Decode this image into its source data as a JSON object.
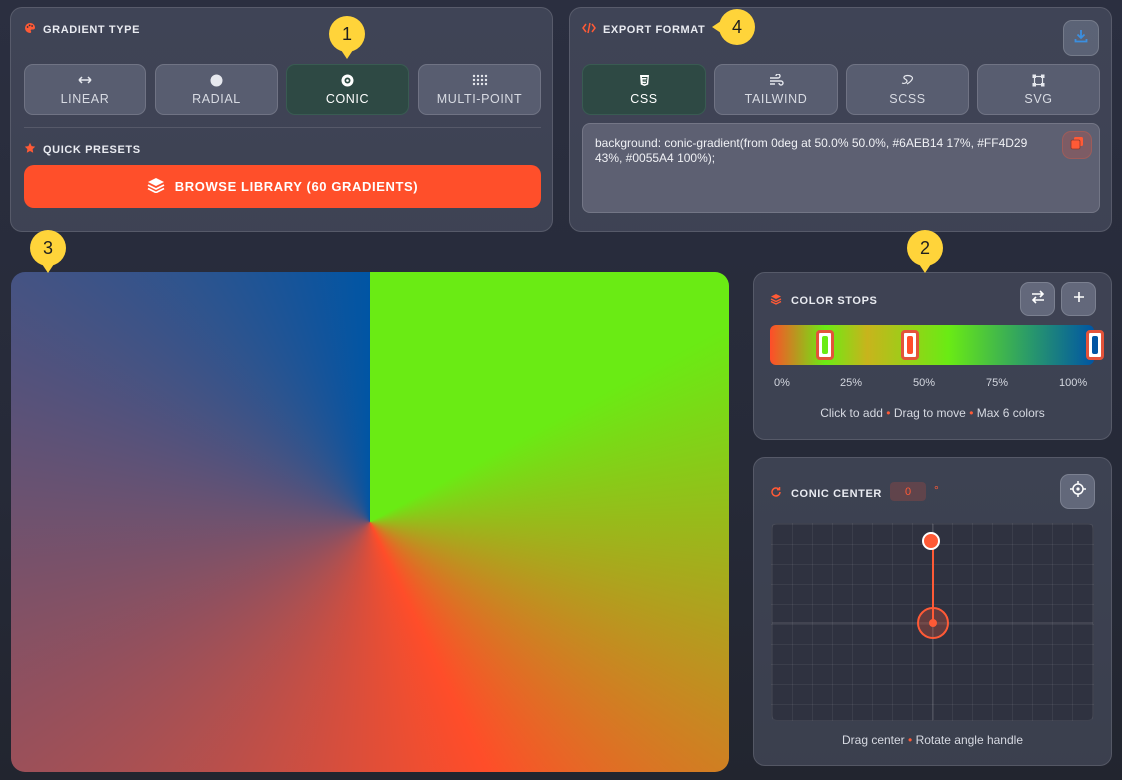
{
  "gradient_type": {
    "title": "GRADIENT TYPE",
    "buttons": [
      {
        "label": "LINEAR",
        "icon": "arrows-horizontal-icon"
      },
      {
        "label": "RADIAL",
        "icon": "circle-icon"
      },
      {
        "label": "CONIC",
        "icon": "conic-icon",
        "active": true
      },
      {
        "label": "MULTI-POINT",
        "icon": "grid-dots-icon"
      }
    ]
  },
  "presets": {
    "title": "QUICK PRESETS",
    "browse_label": "BROWSE LIBRARY (60 GRADIENTS)"
  },
  "export": {
    "title": "EXPORT FORMAT",
    "formats": [
      {
        "label": "CSS",
        "icon": "css3-icon",
        "active": true
      },
      {
        "label": "TAILWIND",
        "icon": "wind-icon"
      },
      {
        "label": "SCSS",
        "icon": "sass-icon"
      },
      {
        "label": "SVG",
        "icon": "vector-square-icon"
      }
    ],
    "code": "background: conic-gradient(from 0deg at 50.0% 50.0%, #6AEB14 17%, #FF4D29 43%, #0055A4 100%);"
  },
  "color_stops": {
    "title": "COLOR STOPS",
    "stops": [
      {
        "color": "#6AEB14",
        "position": 17
      },
      {
        "color": "#FF4D29",
        "position": 43
      },
      {
        "color": "#0055A4",
        "position": 100
      }
    ],
    "ticks": [
      "0%",
      "25%",
      "50%",
      "75%",
      "100%"
    ],
    "hint_parts": [
      "Click to add",
      "Drag to move",
      "Max 6 colors"
    ]
  },
  "conic_center": {
    "title": "CONIC CENTER",
    "angle": "0",
    "unit": "°",
    "hint_parts": [
      "Drag center",
      "Rotate angle handle"
    ]
  },
  "badges": [
    "1",
    "2",
    "3",
    "4"
  ],
  "colors": {
    "accent": "#FF4F2A",
    "badge": "#FFD43A",
    "active_button": "#2C4A42"
  }
}
